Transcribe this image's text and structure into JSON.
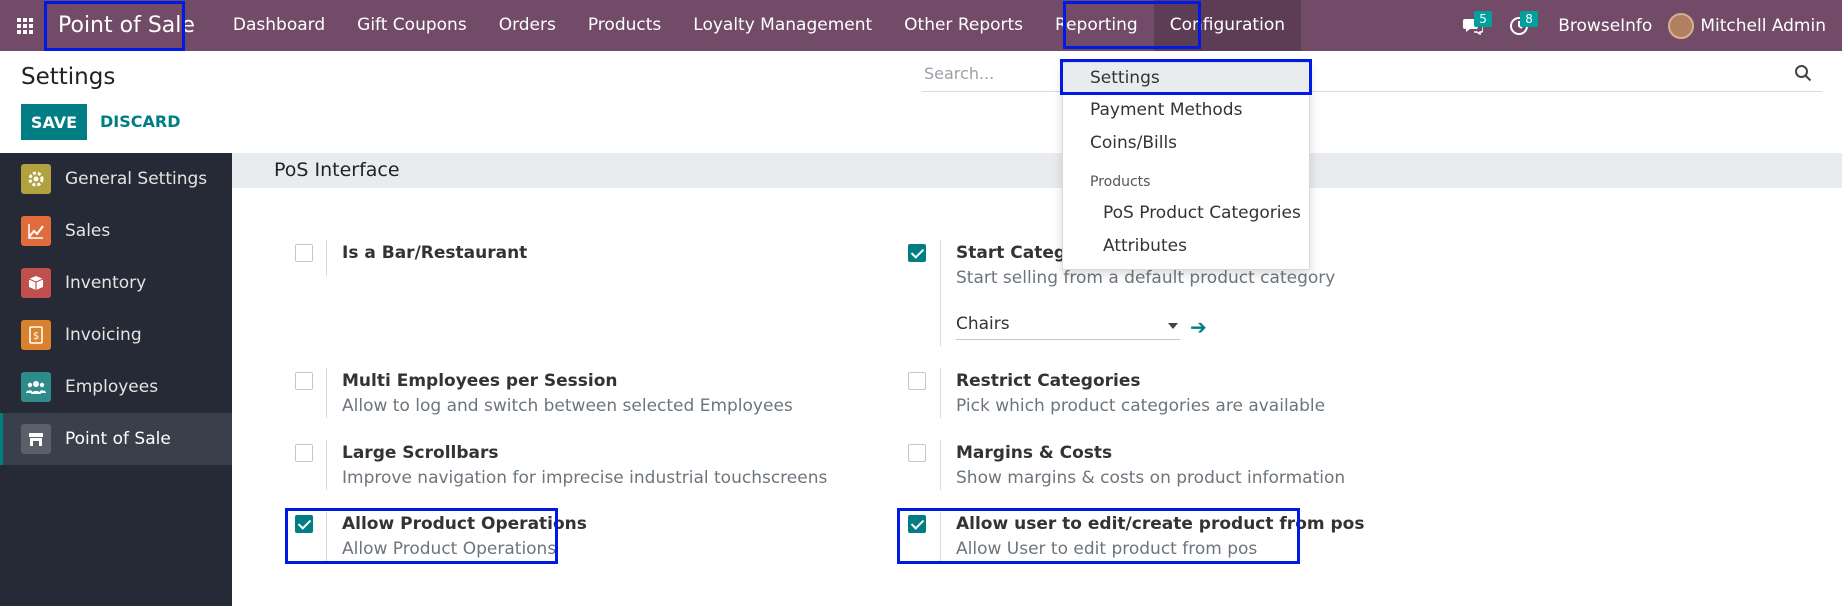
{
  "navbar": {
    "brand": "Point of Sale",
    "menu": [
      "Dashboard",
      "Gift Coupons",
      "Orders",
      "Products",
      "Loyalty Management",
      "Other Reports",
      "Reporting",
      "Configuration"
    ],
    "messages_count": "5",
    "activities_count": "8",
    "company": "BrowseInfo",
    "user": "Mitchell Admin"
  },
  "control_panel": {
    "title": "Settings",
    "save_label": "SAVE",
    "discard_label": "DISCARD",
    "search_placeholder": "Search..."
  },
  "sidebar": {
    "items": [
      {
        "label": "General Settings",
        "icon": "gear-icon",
        "color": "#b1a13f"
      },
      {
        "label": "Sales",
        "icon": "chart-icon",
        "color": "#e06c3c"
      },
      {
        "label": "Inventory",
        "icon": "box-icon",
        "color": "#c0504d"
      },
      {
        "label": "Invoicing",
        "icon": "invoice-icon",
        "color": "#d9822b"
      },
      {
        "label": "Employees",
        "icon": "people-icon",
        "color": "#2d8c8a"
      },
      {
        "label": "Point of Sale",
        "icon": "store-icon",
        "color": "#5a5f69"
      }
    ]
  },
  "section": {
    "title": "PoS Interface",
    "settings": [
      {
        "title": "Is a Bar/Restaurant",
        "desc": "",
        "checked": false
      },
      {
        "title": "Start Category",
        "desc": "Start selling from a default product category",
        "checked": true,
        "select_value": "Chairs"
      },
      {
        "title": "Multi Employees per Session",
        "desc": "Allow to log and switch between selected Employees",
        "checked": false
      },
      {
        "title": "Restrict Categories",
        "desc": "Pick which product categories are available",
        "checked": false
      },
      {
        "title": "Large Scrollbars",
        "desc": "Improve navigation for imprecise industrial touchscreens",
        "checked": false
      },
      {
        "title": "Margins & Costs",
        "desc": "Show margins & costs on product information",
        "checked": false
      },
      {
        "title": "Allow Product Operations",
        "desc": "Allow Product Operations",
        "checked": true
      },
      {
        "title": "Allow user to edit/create product from pos",
        "desc": "Allow User to edit product from pos",
        "checked": true
      }
    ]
  },
  "config_dropdown": {
    "items": [
      "Settings",
      "Payment Methods",
      "Coins/Bills"
    ],
    "products_header": "Products",
    "product_items": [
      "PoS Product Categories",
      "Attributes"
    ]
  },
  "colors": {
    "navbar": "#714b67",
    "primary": "#017e84",
    "highlight": "#0019e6",
    "sidebar": "#262a36"
  }
}
